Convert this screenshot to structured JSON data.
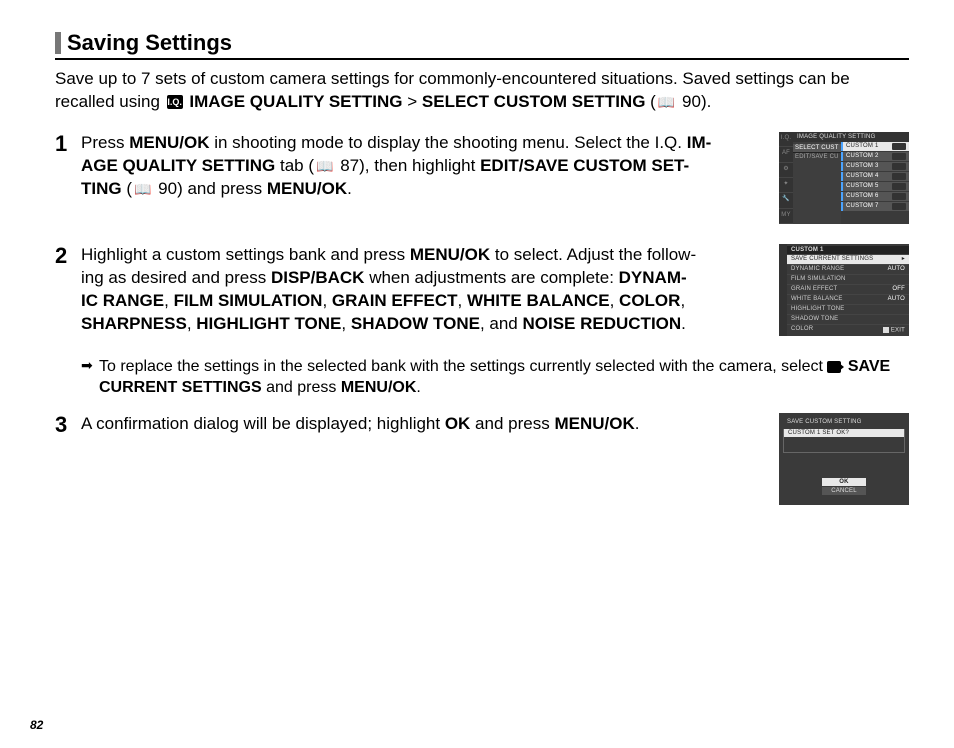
{
  "section_title": "Saving Settings",
  "intro": {
    "pre": "Save up to 7 sets of custom camera settings for commonly-encountered situations.  Saved settings can be recalled using ",
    "iq": "IMAGE QUALITY SETTING",
    "gt": " > ",
    "sc": "SELECT CUSTOM SETTING",
    "tail": " (",
    "page_ref": "90",
    "close": ")."
  },
  "step1": {
    "num": "1",
    "t1": "Press ",
    "menuok": "MENU/OK",
    "t2": " in shooting mode to display the shooting menu.  Select the ",
    "iq1": "IM-",
    "iq2": "AGE QUALITY SETTING",
    "t3": " tab (",
    "ref1": "87",
    "t4": "), then highlight ",
    "edit": "EDIT/SAVE CUSTOM SET-",
    "ting": "TING",
    "t5": " (",
    "ref2": "90",
    "t6": ") and press ",
    "t7": "."
  },
  "step2": {
    "num": "2",
    "t1": "Highlight a custom settings bank and press ",
    "menuok": "MENU/OK",
    "t2": " to select.  Adjust the follow-",
    "t3": "ing as desired and press ",
    "disp": "DISP/BACK",
    "t4": " when adjustments are complete: ",
    "list": [
      "DYNAM-",
      "IC RANGE",
      "FILM SIMULATION",
      "GRAIN EFFECT",
      "WHITE BALANCE",
      "COLOR",
      "SHARPNESS",
      "HIGHLIGHT TONE",
      "SHADOW TONE",
      "NOISE REDUCTION"
    ],
    "sep": ", ",
    "and": ", and ",
    "period": "."
  },
  "sub": {
    "arrow": "➡",
    "t1": "To replace the settings in the selected bank with the settings currently selected with the camera, select ",
    "save": "SAVE CURRENT SETTINGS",
    "t2": " and press ",
    "menuok": "MENU/OK",
    "t3": "."
  },
  "step3": {
    "num": "3",
    "t1": "A confirmation dialog will be displayed; highlight ",
    "ok": "OK",
    "t2": " and press ",
    "menuok": "MENU/OK",
    "t3": "."
  },
  "screen1": {
    "title": "IMAGE QUALITY SETTING",
    "left1": "SELECT CUST",
    "left2": "EDIT/SAVE CU",
    "rows": [
      "CUSTOM 1",
      "CUSTOM 2",
      "CUSTOM 3",
      "CUSTOM 4",
      "CUSTOM 5",
      "CUSTOM 6",
      "CUSTOM 7"
    ]
  },
  "screen2": {
    "title": "CUSTOM 1",
    "rows": [
      {
        "l": "SAVE CURRENT SETTINGS",
        "v": "▸"
      },
      {
        "l": "DYNAMIC RANGE",
        "v": "AUTO"
      },
      {
        "l": "FILM SIMULATION",
        "v": ""
      },
      {
        "l": "GRAIN EFFECT",
        "v": "OFF"
      },
      {
        "l": "WHITE BALANCE",
        "v": "AUTO"
      },
      {
        "l": "HIGHLIGHT TONE",
        "v": ""
      },
      {
        "l": "SHADOW TONE",
        "v": ""
      },
      {
        "l": "COLOR",
        "v": ""
      }
    ],
    "exit": "EXIT"
  },
  "screen3": {
    "title": "SAVE CUSTOM SETTING",
    "question": "CUSTOM 1 SET OK?",
    "ok": "OK",
    "cancel": "CANCEL"
  },
  "page_number": "82"
}
